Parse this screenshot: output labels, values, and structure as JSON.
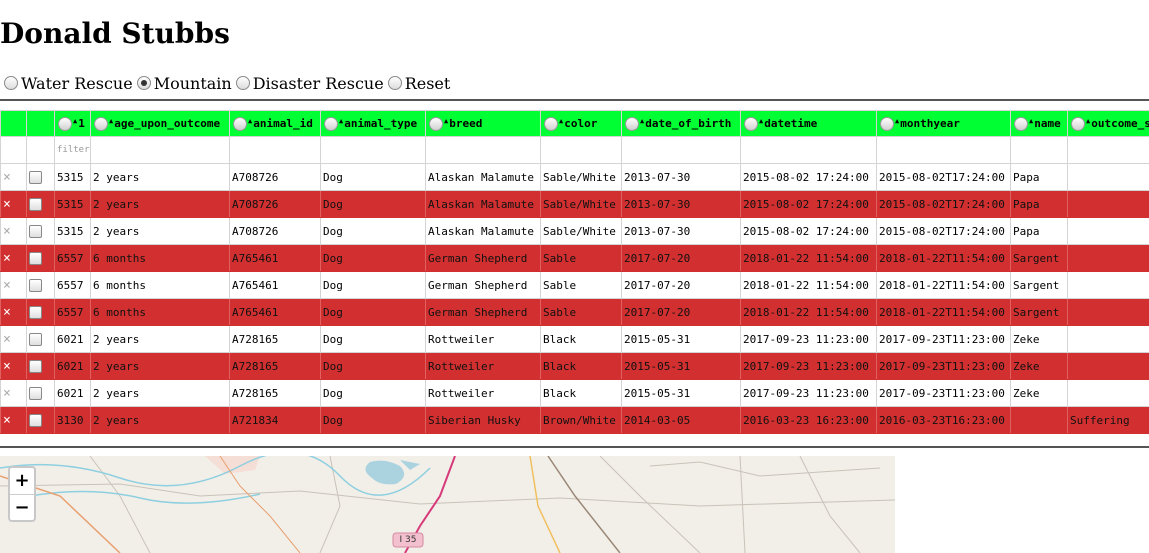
{
  "page": {
    "title": "Donald Stubbs"
  },
  "filters": {
    "options": [
      {
        "label": "Water Rescue",
        "checked": false
      },
      {
        "label": "Mountain",
        "checked": true
      },
      {
        "label": "Disaster Rescue",
        "checked": false
      },
      {
        "label": "Reset",
        "checked": false
      }
    ]
  },
  "table": {
    "columns": [
      "1",
      "age_upon_outcome",
      "animal_id",
      "animal_type",
      "breed",
      "color",
      "date_of_birth",
      "datetime",
      "monthyear",
      "name",
      "outcome_s"
    ],
    "filter_placeholder": "filter",
    "delete_symbol": "×",
    "rows": [
      {
        "highlight": false,
        "cells": [
          "5315",
          "2 years",
          "A708726",
          "Dog",
          "Alaskan Malamute",
          "Sable/White",
          "2013-07-30",
          "2015-08-02 17:24:00",
          "2015-08-02T17:24:00",
          "Papa",
          ""
        ]
      },
      {
        "highlight": true,
        "cells": [
          "5315",
          "2 years",
          "A708726",
          "Dog",
          "Alaskan Malamute",
          "Sable/White",
          "2013-07-30",
          "2015-08-02 17:24:00",
          "2015-08-02T17:24:00",
          "Papa",
          ""
        ]
      },
      {
        "highlight": false,
        "cells": [
          "5315",
          "2 years",
          "A708726",
          "Dog",
          "Alaskan Malamute",
          "Sable/White",
          "2013-07-30",
          "2015-08-02 17:24:00",
          "2015-08-02T17:24:00",
          "Papa",
          ""
        ]
      },
      {
        "highlight": true,
        "cells": [
          "6557",
          "6 months",
          "A765461",
          "Dog",
          "German Shepherd",
          "Sable",
          "2017-07-20",
          "2018-01-22 11:54:00",
          "2018-01-22T11:54:00",
          "Sargent",
          ""
        ]
      },
      {
        "highlight": false,
        "cells": [
          "6557",
          "6 months",
          "A765461",
          "Dog",
          "German Shepherd",
          "Sable",
          "2017-07-20",
          "2018-01-22 11:54:00",
          "2018-01-22T11:54:00",
          "Sargent",
          ""
        ]
      },
      {
        "highlight": true,
        "cells": [
          "6557",
          "6 months",
          "A765461",
          "Dog",
          "German Shepherd",
          "Sable",
          "2017-07-20",
          "2018-01-22 11:54:00",
          "2018-01-22T11:54:00",
          "Sargent",
          ""
        ]
      },
      {
        "highlight": false,
        "cells": [
          "6021",
          "2 years",
          "A728165",
          "Dog",
          "Rottweiler",
          "Black",
          "2015-05-31",
          "2017-09-23 11:23:00",
          "2017-09-23T11:23:00",
          "Zeke",
          ""
        ]
      },
      {
        "highlight": true,
        "cells": [
          "6021",
          "2 years",
          "A728165",
          "Dog",
          "Rottweiler",
          "Black",
          "2015-05-31",
          "2017-09-23 11:23:00",
          "2017-09-23T11:23:00",
          "Zeke",
          ""
        ]
      },
      {
        "highlight": false,
        "cells": [
          "6021",
          "2 years",
          "A728165",
          "Dog",
          "Rottweiler",
          "Black",
          "2015-05-31",
          "2017-09-23 11:23:00",
          "2017-09-23T11:23:00",
          "Zeke",
          ""
        ]
      },
      {
        "highlight": true,
        "cells": [
          "3130",
          "2 years",
          "A721834",
          "Dog",
          "Siberian Husky",
          "Brown/White",
          "2014-03-05",
          "2016-03-23 16:23:00",
          "2016-03-23T16:23:00",
          "",
          "Suffering"
        ]
      }
    ]
  },
  "map": {
    "road_label": "I 35",
    "zoom_in": "+",
    "zoom_out": "−"
  },
  "colors": {
    "header_bg": "#00ff33",
    "highlight_row": "#d23030"
  }
}
